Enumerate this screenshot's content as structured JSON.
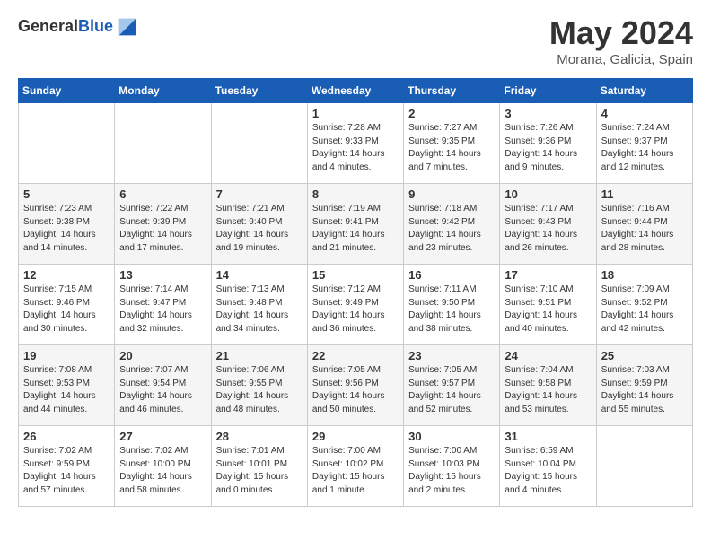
{
  "logo": {
    "general": "General",
    "blue": "Blue"
  },
  "header": {
    "month": "May 2024",
    "location": "Morana, Galicia, Spain"
  },
  "weekdays": [
    "Sunday",
    "Monday",
    "Tuesday",
    "Wednesday",
    "Thursday",
    "Friday",
    "Saturday"
  ],
  "weeks": [
    [
      {
        "day": "",
        "sunrise": "",
        "sunset": "",
        "daylight": ""
      },
      {
        "day": "",
        "sunrise": "",
        "sunset": "",
        "daylight": ""
      },
      {
        "day": "",
        "sunrise": "",
        "sunset": "",
        "daylight": ""
      },
      {
        "day": "1",
        "sunrise": "7:28 AM",
        "sunset": "9:33 PM",
        "daylight": "14 hours and 4 minutes."
      },
      {
        "day": "2",
        "sunrise": "7:27 AM",
        "sunset": "9:35 PM",
        "daylight": "14 hours and 7 minutes."
      },
      {
        "day": "3",
        "sunrise": "7:26 AM",
        "sunset": "9:36 PM",
        "daylight": "14 hours and 9 minutes."
      },
      {
        "day": "4",
        "sunrise": "7:24 AM",
        "sunset": "9:37 PM",
        "daylight": "14 hours and 12 minutes."
      }
    ],
    [
      {
        "day": "5",
        "sunrise": "7:23 AM",
        "sunset": "9:38 PM",
        "daylight": "14 hours and 14 minutes."
      },
      {
        "day": "6",
        "sunrise": "7:22 AM",
        "sunset": "9:39 PM",
        "daylight": "14 hours and 17 minutes."
      },
      {
        "day": "7",
        "sunrise": "7:21 AM",
        "sunset": "9:40 PM",
        "daylight": "14 hours and 19 minutes."
      },
      {
        "day": "8",
        "sunrise": "7:19 AM",
        "sunset": "9:41 PM",
        "daylight": "14 hours and 21 minutes."
      },
      {
        "day": "9",
        "sunrise": "7:18 AM",
        "sunset": "9:42 PM",
        "daylight": "14 hours and 23 minutes."
      },
      {
        "day": "10",
        "sunrise": "7:17 AM",
        "sunset": "9:43 PM",
        "daylight": "14 hours and 26 minutes."
      },
      {
        "day": "11",
        "sunrise": "7:16 AM",
        "sunset": "9:44 PM",
        "daylight": "14 hours and 28 minutes."
      }
    ],
    [
      {
        "day": "12",
        "sunrise": "7:15 AM",
        "sunset": "9:46 PM",
        "daylight": "14 hours and 30 minutes."
      },
      {
        "day": "13",
        "sunrise": "7:14 AM",
        "sunset": "9:47 PM",
        "daylight": "14 hours and 32 minutes."
      },
      {
        "day": "14",
        "sunrise": "7:13 AM",
        "sunset": "9:48 PM",
        "daylight": "14 hours and 34 minutes."
      },
      {
        "day": "15",
        "sunrise": "7:12 AM",
        "sunset": "9:49 PM",
        "daylight": "14 hours and 36 minutes."
      },
      {
        "day": "16",
        "sunrise": "7:11 AM",
        "sunset": "9:50 PM",
        "daylight": "14 hours and 38 minutes."
      },
      {
        "day": "17",
        "sunrise": "7:10 AM",
        "sunset": "9:51 PM",
        "daylight": "14 hours and 40 minutes."
      },
      {
        "day": "18",
        "sunrise": "7:09 AM",
        "sunset": "9:52 PM",
        "daylight": "14 hours and 42 minutes."
      }
    ],
    [
      {
        "day": "19",
        "sunrise": "7:08 AM",
        "sunset": "9:53 PM",
        "daylight": "14 hours and 44 minutes."
      },
      {
        "day": "20",
        "sunrise": "7:07 AM",
        "sunset": "9:54 PM",
        "daylight": "14 hours and 46 minutes."
      },
      {
        "day": "21",
        "sunrise": "7:06 AM",
        "sunset": "9:55 PM",
        "daylight": "14 hours and 48 minutes."
      },
      {
        "day": "22",
        "sunrise": "7:05 AM",
        "sunset": "9:56 PM",
        "daylight": "14 hours and 50 minutes."
      },
      {
        "day": "23",
        "sunrise": "7:05 AM",
        "sunset": "9:57 PM",
        "daylight": "14 hours and 52 minutes."
      },
      {
        "day": "24",
        "sunrise": "7:04 AM",
        "sunset": "9:58 PM",
        "daylight": "14 hours and 53 minutes."
      },
      {
        "day": "25",
        "sunrise": "7:03 AM",
        "sunset": "9:59 PM",
        "daylight": "14 hours and 55 minutes."
      }
    ],
    [
      {
        "day": "26",
        "sunrise": "7:02 AM",
        "sunset": "9:59 PM",
        "daylight": "14 hours and 57 minutes."
      },
      {
        "day": "27",
        "sunrise": "7:02 AM",
        "sunset": "10:00 PM",
        "daylight": "14 hours and 58 minutes."
      },
      {
        "day": "28",
        "sunrise": "7:01 AM",
        "sunset": "10:01 PM",
        "daylight": "15 hours and 0 minutes."
      },
      {
        "day": "29",
        "sunrise": "7:00 AM",
        "sunset": "10:02 PM",
        "daylight": "15 hours and 1 minute."
      },
      {
        "day": "30",
        "sunrise": "7:00 AM",
        "sunset": "10:03 PM",
        "daylight": "15 hours and 2 minutes."
      },
      {
        "day": "31",
        "sunrise": "6:59 AM",
        "sunset": "10:04 PM",
        "daylight": "15 hours and 4 minutes."
      },
      {
        "day": "",
        "sunrise": "",
        "sunset": "",
        "daylight": ""
      }
    ]
  ]
}
